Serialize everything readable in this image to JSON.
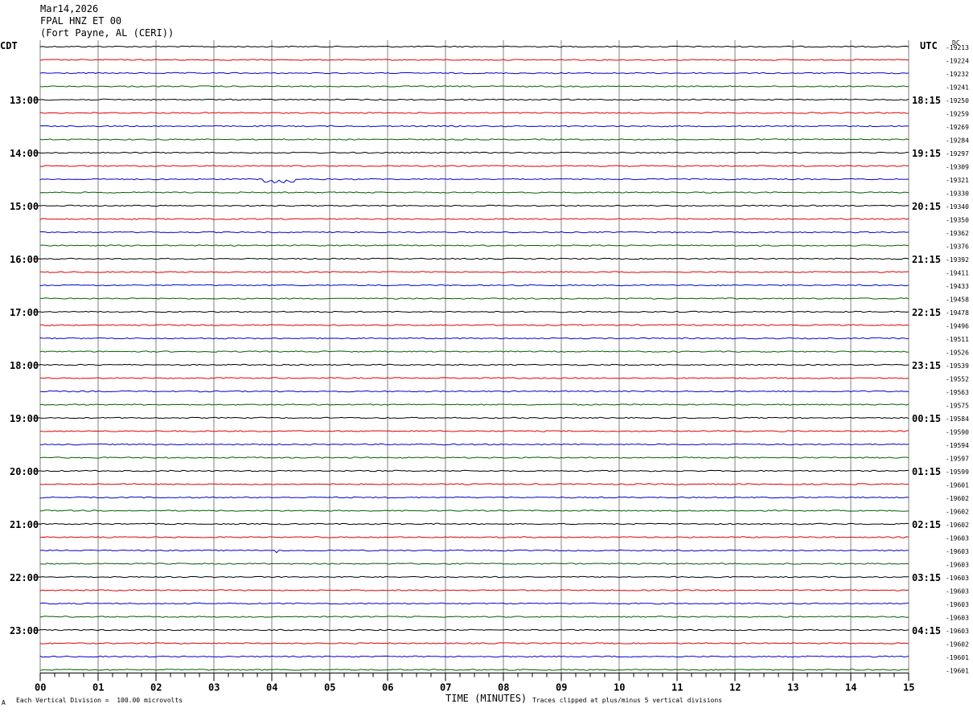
{
  "header": {
    "date": "Mar14,2026",
    "station": "FPAL HNZ ET 00",
    "location": "(Fort Payne, AL (CERI))"
  },
  "left_tz": "CDT",
  "right_tz": "UTC",
  "dc_label": "DC",
  "footer": {
    "scale_note": "Each Vertical Division =  100.00 microvolts",
    "xlabel": "TIME (MINUTES)",
    "clip_note": "Traces clipped at plus/minus 5 vertical divisions",
    "corner_mark": "A"
  },
  "colors": {
    "cycle": [
      "#000000",
      "#e00000",
      "#0000d0",
      "#006000"
    ],
    "grid": "#808080"
  },
  "chart_data": {
    "type": "line",
    "title": "FPAL HNZ ET 00",
    "xlabel": "TIME (MINUTES)",
    "ylabel": "",
    "xlim": [
      0,
      15
    ],
    "x_ticks": [
      "00",
      "01",
      "02",
      "03",
      "04",
      "05",
      "06",
      "07",
      "08",
      "09",
      "10",
      "11",
      "12",
      "13",
      "14",
      "15"
    ],
    "left_hour_labels": [
      "13:00",
      "14:00",
      "15:00",
      "16:00",
      "17:00",
      "18:00",
      "19:00",
      "20:00",
      "21:00",
      "22:00",
      "23:00"
    ],
    "right_hour_labels": [
      "18:15",
      "19:15",
      "20:15",
      "21:15",
      "22:15",
      "23:15",
      "00:15",
      "01:15",
      "02:15",
      "03:15",
      "04:15"
    ],
    "hour_label_first_trace": 4,
    "hour_label_every": 4,
    "dc_offsets": [
      "-19213",
      "-19224",
      "-19232",
      "-19241",
      "-19250",
      "-19259",
      "-19269",
      "-19284",
      "-19297",
      "-19309",
      "-19321",
      "-19330",
      "-19340",
      "-19350",
      "-19362",
      "-19376",
      "-19392",
      "-19411",
      "-19433",
      "-19458",
      "-19478",
      "-19496",
      "-19511",
      "-19526",
      "-19539",
      "-19552",
      "-19563",
      "-19575",
      "-19584",
      "-19590",
      "-19594",
      "-19597",
      "-19599",
      "-19601",
      "-19602",
      "-19602",
      "-19602",
      "-19603",
      "-19603",
      "-19603",
      "-19603",
      "-19603",
      "-19603",
      "-19603",
      "-19603",
      "-19602",
      "-19601",
      "-19601"
    ],
    "events": [
      {
        "trace": 10,
        "start_min": 3.85,
        "end_min": 4.4,
        "amplitude_div": 0.4,
        "note": "small step offsets on blue trace"
      },
      {
        "trace": 38,
        "start_min": 4.05,
        "end_min": 4.1,
        "amplitude_div": 0.3,
        "note": "single spike"
      }
    ],
    "grid": true
  }
}
